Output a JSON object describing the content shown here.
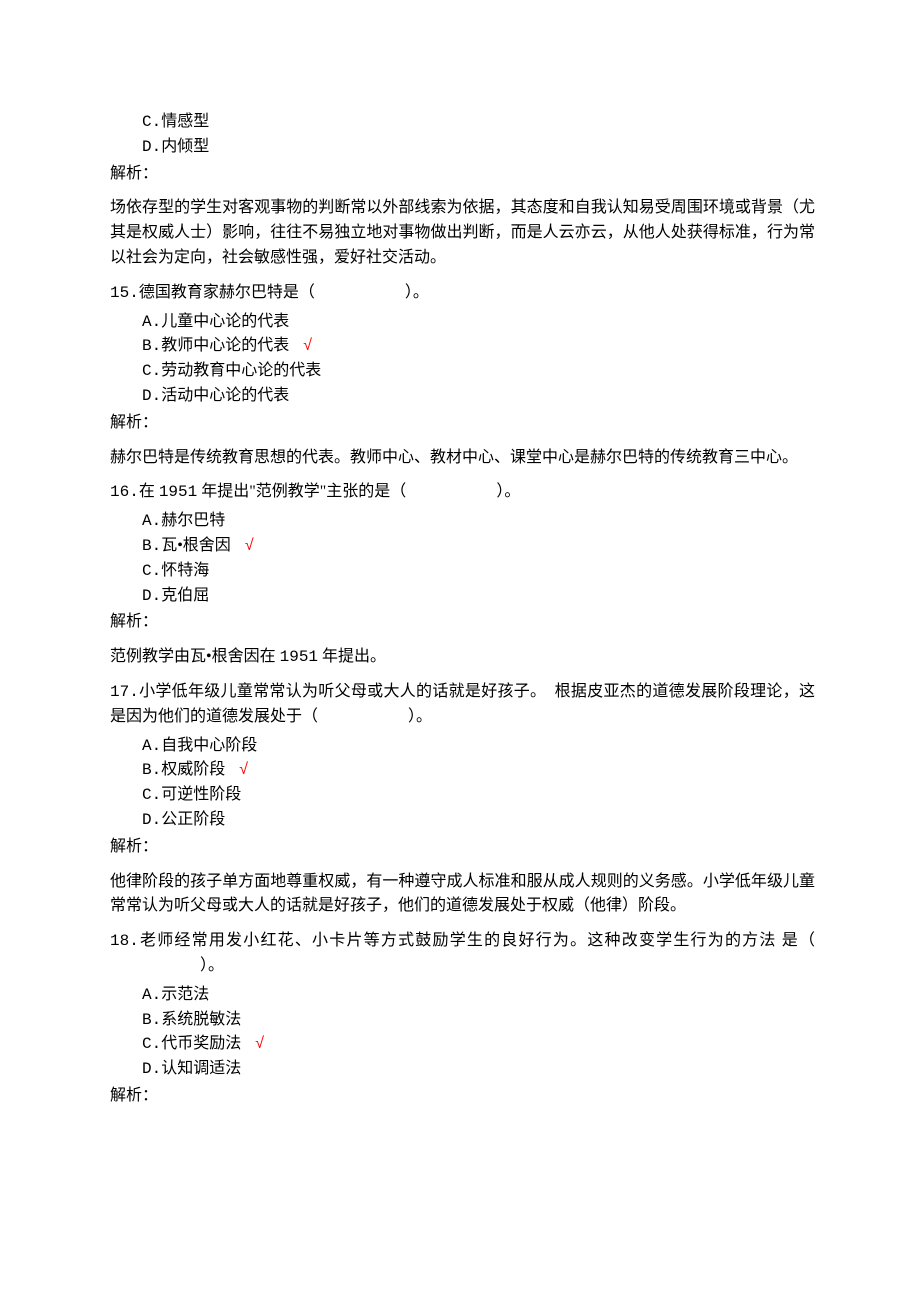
{
  "q14_tail": {
    "options": {
      "c": {
        "letter": "C.",
        "text": "情感型"
      },
      "d": {
        "letter": "D.",
        "text": "内倾型"
      }
    },
    "analysis_label": "解析：",
    "analysis": "场依存型的学生对客观事物的判断常以外部线索为依据，其态度和自我认知易受周围环境或背景（尤其是权威人士）影响，往往不易独立地对事物做出判断，而是人云亦云，从他人处获得标准，行为常以社会为定向，社会敏感性强，爱好社交活动。"
  },
  "q15": {
    "number": "15.",
    "stem_text": "德国教育家赫尔巴特是（",
    "stem_end": "）。",
    "options": {
      "a": {
        "letter": "A.",
        "text": "儿童中心论的代表"
      },
      "b": {
        "letter": "B.",
        "text": "教师中心论的代表"
      },
      "c": {
        "letter": "C.",
        "text": "劳动教育中心论的代表"
      },
      "d": {
        "letter": "D.",
        "text": "活动中心论的代表"
      }
    },
    "correct": "b",
    "check": "√",
    "analysis_label": "解析：",
    "analysis": "赫尔巴特是传统教育思想的代表。教师中心、教材中心、课堂中心是赫尔巴特的传统教育三中心。"
  },
  "q16": {
    "number": "16.",
    "stem_pre": "在 ",
    "stem_year": "1951",
    "stem_mid": " 年提出\"范例教学\"主张的是（",
    "stem_end": "）。",
    "options": {
      "a": {
        "letter": "A.",
        "text": "赫尔巴特"
      },
      "b": {
        "letter": "B.",
        "text": "瓦•根舍因"
      },
      "c": {
        "letter": "C.",
        "text": "怀特海"
      },
      "d": {
        "letter": "D.",
        "text": "克伯屈"
      }
    },
    "correct": "b",
    "check": "√",
    "analysis_label": "解析：",
    "analysis_pre": "范例教学由瓦•根舍因在 ",
    "analysis_year": "1951",
    "analysis_post": " 年提出。"
  },
  "q17": {
    "number": "17.",
    "stem": "小学低年级儿童常常认为听父母或大人的话就是好孩子。　根据皮亚杰的道德发展阶段理论，这是因为他们的道德发展处于（",
    "stem_end": "）。",
    "options": {
      "a": {
        "letter": "A.",
        "text": "自我中心阶段"
      },
      "b": {
        "letter": "B.",
        "text": "权威阶段"
      },
      "c": {
        "letter": "C.",
        "text": "可逆性阶段"
      },
      "d": {
        "letter": "D.",
        "text": "公正阶段"
      }
    },
    "correct": "b",
    "check": "√",
    "analysis_label": "解析：",
    "analysis": "他律阶段的孩子单方面地尊重权威，有一种遵守成人标准和服从成人规则的义务感。小学低年级儿童常常认为听父母或大人的话就是好孩子，他们的道德发展处于权威（他律）阶段。"
  },
  "q18": {
    "number": "18.",
    "stem": "老师经常用发小红花、小卡片等方式鼓励学生的良好行为。这种改变学生行为的方法 是（",
    "stem_end": "）。",
    "options": {
      "a": {
        "letter": "A.",
        "text": "示范法"
      },
      "b": {
        "letter": "B.",
        "text": "系统脱敏法"
      },
      "c": {
        "letter": "C.",
        "text": "代币奖励法"
      },
      "d": {
        "letter": "D.",
        "text": "认知调适法"
      }
    },
    "correct": "c",
    "check": "√",
    "analysis_label": "解析："
  }
}
